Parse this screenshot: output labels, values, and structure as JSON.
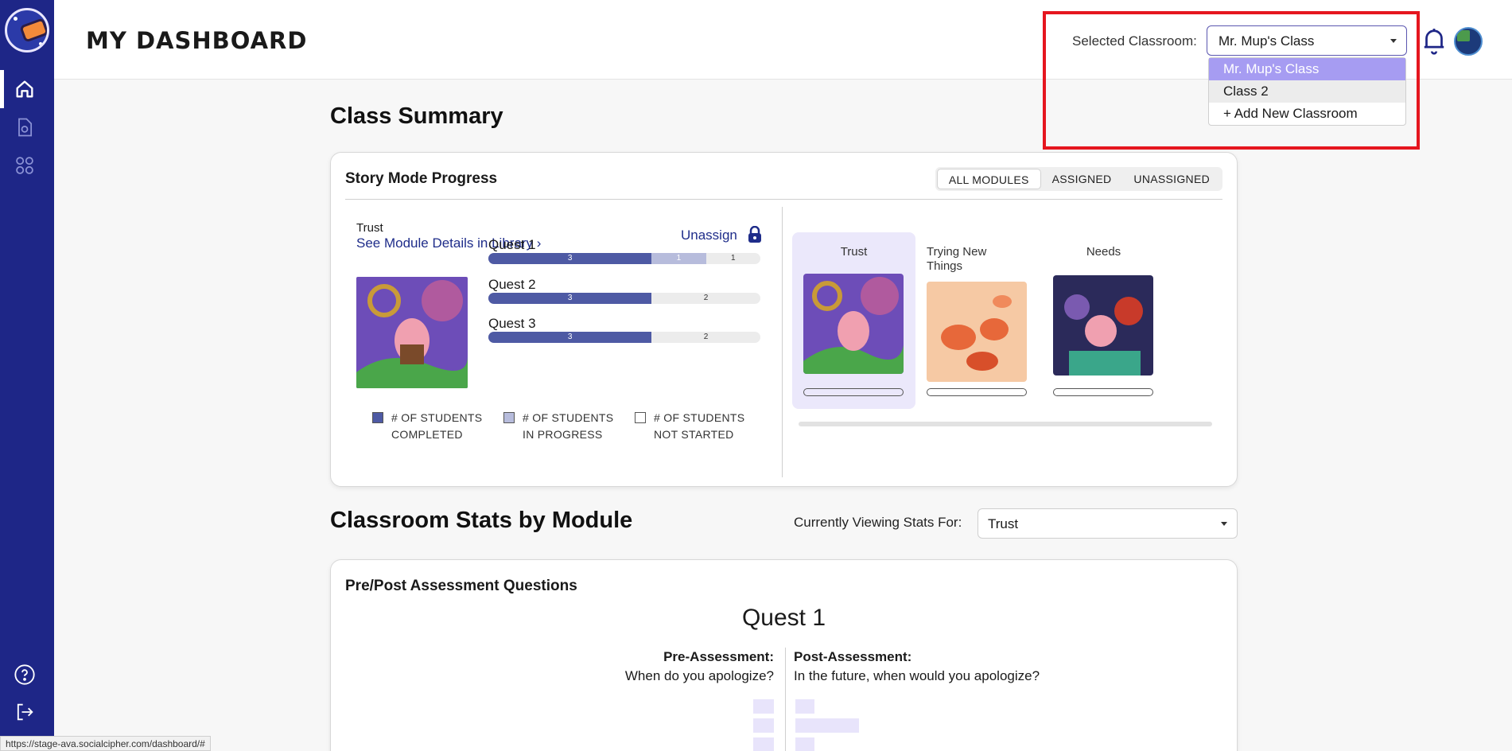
{
  "sidebar": {
    "logo": "telescope-logo",
    "nav": [
      {
        "icon": "home-icon",
        "active": true
      },
      {
        "icon": "document-icon",
        "active": false
      },
      {
        "icon": "grid-icon",
        "active": false
      }
    ],
    "bottom": [
      {
        "icon": "help-icon"
      },
      {
        "icon": "logout-icon"
      }
    ]
  },
  "header": {
    "title": "MY DASHBOARD",
    "classroom_label": "Selected Classroom:",
    "classroom_value": "Mr. Mup's Class",
    "bell_icon": "bell-icon",
    "avatar_icon": "avatar-image"
  },
  "classroom_dropdown": {
    "options": [
      "Mr. Mup's Class",
      "Class 2",
      "+ Add New Classroom"
    ],
    "selected_index": 0,
    "hover_index": 1
  },
  "class_summary": {
    "title": "Class Summary",
    "card_title": "Story Mode Progress",
    "filters": [
      "ALL MODULES",
      "ASSIGNED",
      "UNASSIGNED"
    ],
    "active_filter": 0,
    "module_label": "Trust",
    "module_link": "See Module Details in Library",
    "unassign": "Unassign",
    "quests": [
      {
        "name": "Quest 1",
        "completed": 3,
        "in_progress": 1,
        "not_started": 1
      },
      {
        "name": "Quest 2",
        "completed": 3,
        "in_progress": 0,
        "not_started": 2
      },
      {
        "name": "Quest 3",
        "completed": 3,
        "in_progress": 0,
        "not_started": 2
      }
    ],
    "legend": [
      {
        "line1": "# OF STUDENTS",
        "line2": "COMPLETED",
        "color": "#4e5aa4"
      },
      {
        "line1": "# OF STUDENTS",
        "line2": "IN PROGRESS",
        "color": "#b7bcdc"
      },
      {
        "line1": "# OF STUDENTS",
        "line2": "NOT STARTED",
        "color": "#ffffff"
      }
    ],
    "modules": [
      {
        "name": "Trust",
        "active": true
      },
      {
        "name": "Trying New Things",
        "active": false
      },
      {
        "name": "Needs",
        "active": false
      }
    ]
  },
  "classroom_stats": {
    "title": "Classroom Stats by Module",
    "viewing_label": "Currently Viewing Stats For:",
    "viewing_value": "Trust",
    "card_title": "Pre/Post Assessment Questions",
    "quest_heading": "Quest 1",
    "pre_label": "Pre-Assessment:",
    "pre_question": "When do you apologize?",
    "post_label": "Post-Assessment:",
    "post_question": "In the future, when would you apologize?"
  },
  "status_bar": {
    "url": "https://stage-ava.socialcipher.com/dashboard/#"
  },
  "colors": {
    "sidebar": "#1e2687",
    "accent": "#a69cf2",
    "completed": "#4e5aa4",
    "in_progress": "#b7bcdc",
    "highlight": "#e5161f"
  }
}
